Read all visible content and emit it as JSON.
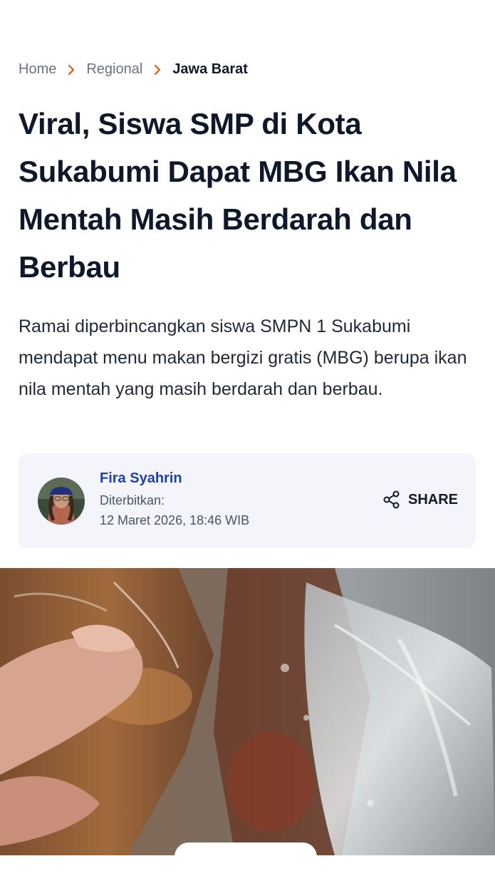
{
  "breadcrumb": {
    "items": [
      {
        "label": "Home"
      },
      {
        "label": "Regional"
      },
      {
        "label": "Jawa Barat"
      }
    ]
  },
  "article": {
    "title": "Viral, Siswa SMP di Kota Sukabumi Dapat MBG Ikan Nila Mentah Masih Berdarah dan Berbau",
    "summary": "Ramai diperbincangkan siswa SMPN 1 Sukabumi mendapat menu makan bergizi gratis (MBG) berupa ikan nila mentah yang masih berdarah dan berbau."
  },
  "author": {
    "name": "Fira Syahrin",
    "published_label": "Diterbitkan:",
    "published_date": "12 Maret 2026, 18:46 WIB"
  },
  "share": {
    "label": "SHARE",
    "icon": "share-icon"
  },
  "colors": {
    "breadcrumb_separator": "#ea580c",
    "author_name": "#1e40af",
    "card_background": "#f4f5fa"
  }
}
